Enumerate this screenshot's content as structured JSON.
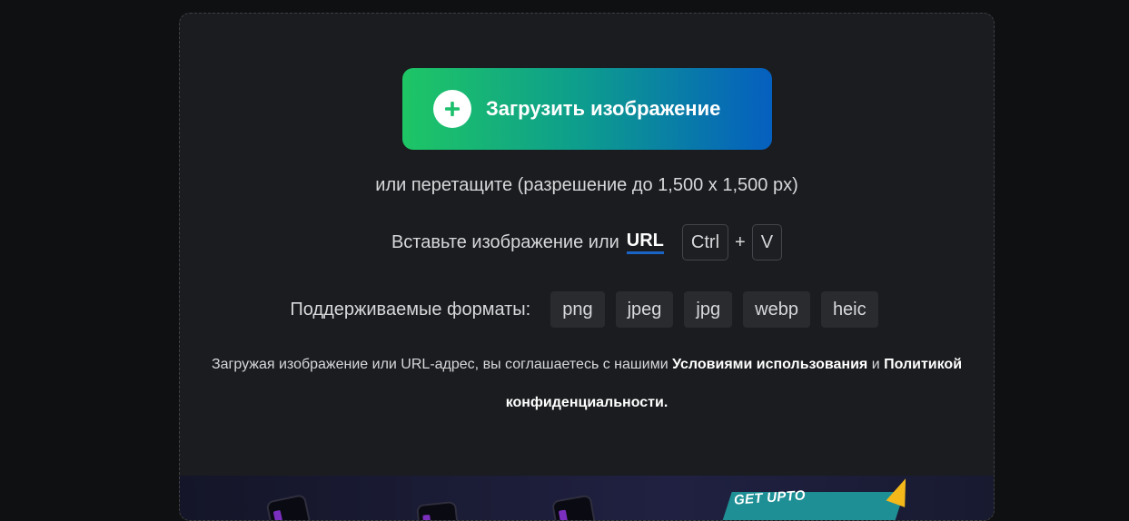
{
  "upload": {
    "button_label": "Загрузить изображение",
    "drag_hint": "или перетащите (разрешение до 1,500 x 1,500 px)"
  },
  "paste": {
    "text": "Вставьте изображение или",
    "url_label": "URL",
    "key_ctrl": "Ctrl",
    "plus": "+",
    "key_v": "V"
  },
  "formats": {
    "label": "Поддерживаемые форматы:",
    "items": [
      "png",
      "jpeg",
      "jpg",
      "webp",
      "heic"
    ]
  },
  "terms": {
    "prefix": "Загружая изображение или URL-адрес, вы соглашаетесь с нашими",
    "terms_link": "Условиями использования",
    "and": "и",
    "privacy_link": "Политикой конфиденциальности."
  },
  "promo": {
    "text": "GET UPTO"
  },
  "colors": {
    "background": "#0f1011",
    "card": "#1b1c1f",
    "gradient_start": "#1ec665",
    "gradient_end": "#055fbf",
    "url_underline": "#1a64c8"
  }
}
